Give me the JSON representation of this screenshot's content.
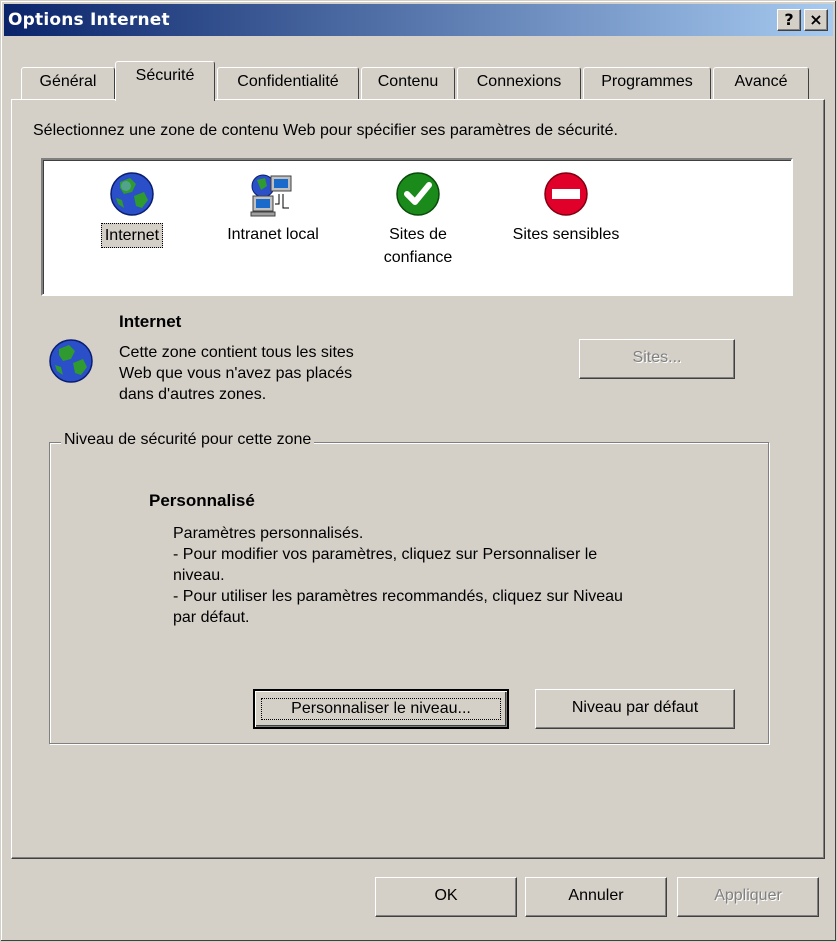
{
  "window": {
    "title": "Options Internet",
    "help_glyph": "?",
    "close_glyph": "×"
  },
  "tabs": [
    {
      "label": "Général"
    },
    {
      "label": "Sécurité",
      "active": true
    },
    {
      "label": "Confidentialité"
    },
    {
      "label": "Contenu"
    },
    {
      "label": "Connexions"
    },
    {
      "label": "Programmes"
    },
    {
      "label": "Avancé"
    }
  ],
  "instruction": "Sélectionnez une zone de contenu Web pour spécifier ses paramètres de sécurité.",
  "zones": [
    {
      "label": "Internet",
      "icon": "globe-icon",
      "selected": true
    },
    {
      "label": "Intranet local",
      "icon": "intranet-computers-icon"
    },
    {
      "label_line1": "Sites de",
      "label_line2": "confiance",
      "icon": "check-circle-icon"
    },
    {
      "label": "Sites sensibles",
      "icon": "no-entry-icon"
    }
  ],
  "selected_zone": {
    "name": "Internet",
    "description_lines": [
      "Cette zone contient tous les sites",
      "Web que vous n'avez pas placés",
      "dans d'autres zones."
    ],
    "sites_button": "Sites..."
  },
  "security_level": {
    "group_label": "Niveau de sécurité pour cette zone",
    "level_name": "Personnalisé",
    "description_lines": [
      "Paramètres personnalisés.",
      "- Pour modifier vos paramètres, cliquez sur Personnaliser le",
      "niveau.",
      "- Pour utiliser les paramètres recommandés, cliquez sur Niveau",
      "par défaut."
    ],
    "custom_button": "Personnaliser le niveau...",
    "default_button": "Niveau par défaut"
  },
  "footer": {
    "ok": "OK",
    "cancel": "Annuler",
    "apply": "Appliquer"
  },
  "colors": {
    "face": "#d4d0c8",
    "title_start": "#0a246a",
    "title_end": "#a6caf0",
    "green": "#1a8a1a",
    "red": "#e0002a"
  }
}
